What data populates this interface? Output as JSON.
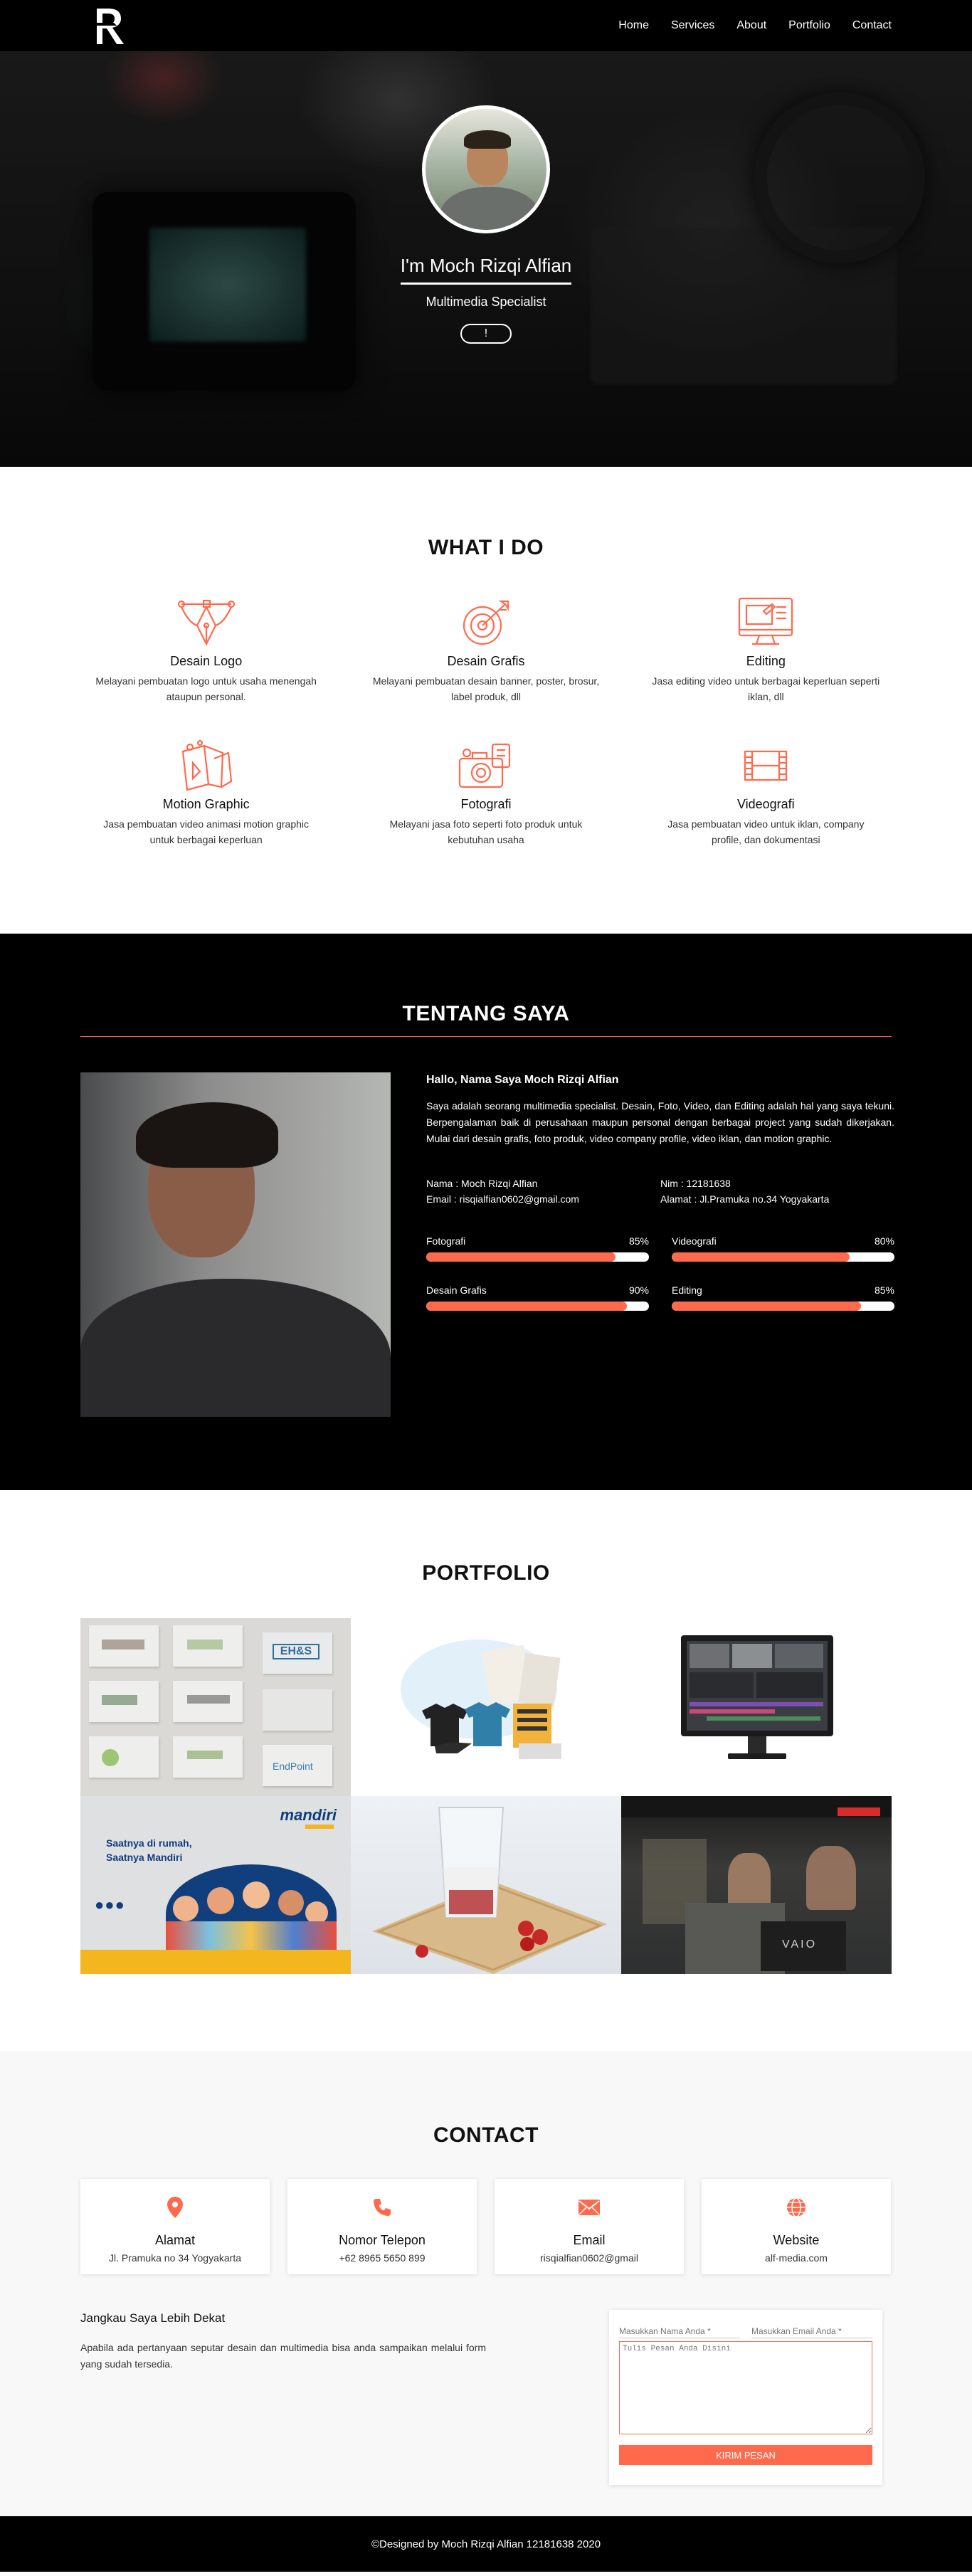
{
  "nav": {
    "links": [
      "Home",
      "Services",
      "About",
      "Portfolio",
      "Contact"
    ]
  },
  "hero": {
    "name": "I'm Moch Rizqi Alfian",
    "role": "Multimedia Specialist",
    "button_glyph": "!"
  },
  "services": {
    "title": "WHAT I DO",
    "accent_color": "#ff6a4d",
    "items": [
      {
        "icon": "pen-tool-icon",
        "title": "Desain Logo",
        "desc": "Melayani pembuatan logo untuk usaha menengah ataupun personal."
      },
      {
        "icon": "target-icon",
        "title": "Desain Grafis",
        "desc": "Melayani pembuatan desain banner, poster, brosur, label produk, dll"
      },
      {
        "icon": "monitor-edit-icon",
        "title": "Editing",
        "desc": "Jasa editing video untuk berbagai keperluan seperti iklan, dll"
      },
      {
        "icon": "motion-graphic-icon",
        "title": "Motion Graphic",
        "desc": "Jasa pembuatan video animasi motion graphic untuk berbagai keperluan"
      },
      {
        "icon": "camera-icon",
        "title": "Fotografi",
        "desc": "Melayani jasa foto seperti foto produk untuk kebutuhan usaha"
      },
      {
        "icon": "film-strip-icon",
        "title": "Videografi",
        "desc": "Jasa pembuatan video untuk iklan, company profile, dan dokumentasi"
      }
    ]
  },
  "about": {
    "title": "TENTANG SAYA",
    "heading": "Hallo, Nama Saya Moch Rizqi Alfian",
    "description": "Saya adalah seorang multimedia specialist. Desain, Foto, Video, dan Editing adalah hal yang saya tekuni. Berpengalaman baik di perusahaan maupun personal dengan berbagai project yang sudah dikerjakan. Mulai dari desain grafis, foto produk, video company profile, video iklan, dan motion graphic.",
    "info": {
      "nama": "Nama : Moch Rizqi Alfian",
      "email": "Email : risqialfian0602@gmail.com",
      "nim": "Nim : 12181638",
      "alamat": "Alamat : Jl.Pramuka no.34 Yogyakarta"
    },
    "skills": [
      {
        "name": "Fotografi",
        "percent": "85%",
        "value": 85
      },
      {
        "name": "Videografi",
        "percent": "80%",
        "value": 80
      },
      {
        "name": "Desain Grafis",
        "percent": "90%",
        "value": 90
      },
      {
        "name": "Editing",
        "percent": "85%",
        "value": 85
      }
    ]
  },
  "portfolio": {
    "title": "PORTFOLIO",
    "items": [
      {
        "name": "logo-collection"
      },
      {
        "name": "merchandise-design"
      },
      {
        "name": "video-editing-monitor"
      },
      {
        "name": "mandiri-ad",
        "caption_line1": "Saatnya di rumah,",
        "caption_line2": "Saatnya Mandiri",
        "brand": "mandiri"
      },
      {
        "name": "product-photo-drink"
      },
      {
        "name": "office-video-shoot",
        "brand": "VAIO"
      }
    ],
    "logo_labels": [
      "EH&S",
      "EndPoint"
    ]
  },
  "contact": {
    "title": "CONTACT",
    "cards": [
      {
        "icon": "location-pin-icon",
        "title": "Alamat",
        "value": "Jl. Pramuka no 34 Yogyakarta"
      },
      {
        "icon": "phone-icon",
        "title": "Nomor Telepon",
        "value": "+62 8965 5650 899"
      },
      {
        "icon": "mail-icon",
        "title": "Email",
        "value": "risqialfian0602@gmail"
      },
      {
        "icon": "globe-icon",
        "title": "Website",
        "value": "alf-media.com"
      }
    ],
    "reach_title": "Jangkau Saya Lebih Dekat",
    "reach_text": "Apabila ada pertanyaan seputar desain dan multimedia bisa anda sampaikan melalui form yang sudah tersedia.",
    "form": {
      "name_placeholder": "Masukkan Nama Anda *",
      "email_placeholder": "Masukkan Email Anda *",
      "message_placeholder": "Tulis Pesan Anda Disini",
      "submit_label": "KIRIM PESAN"
    }
  },
  "footer": {
    "text": "©Designed by Moch Rizqi Alfian 12181638 2020"
  }
}
